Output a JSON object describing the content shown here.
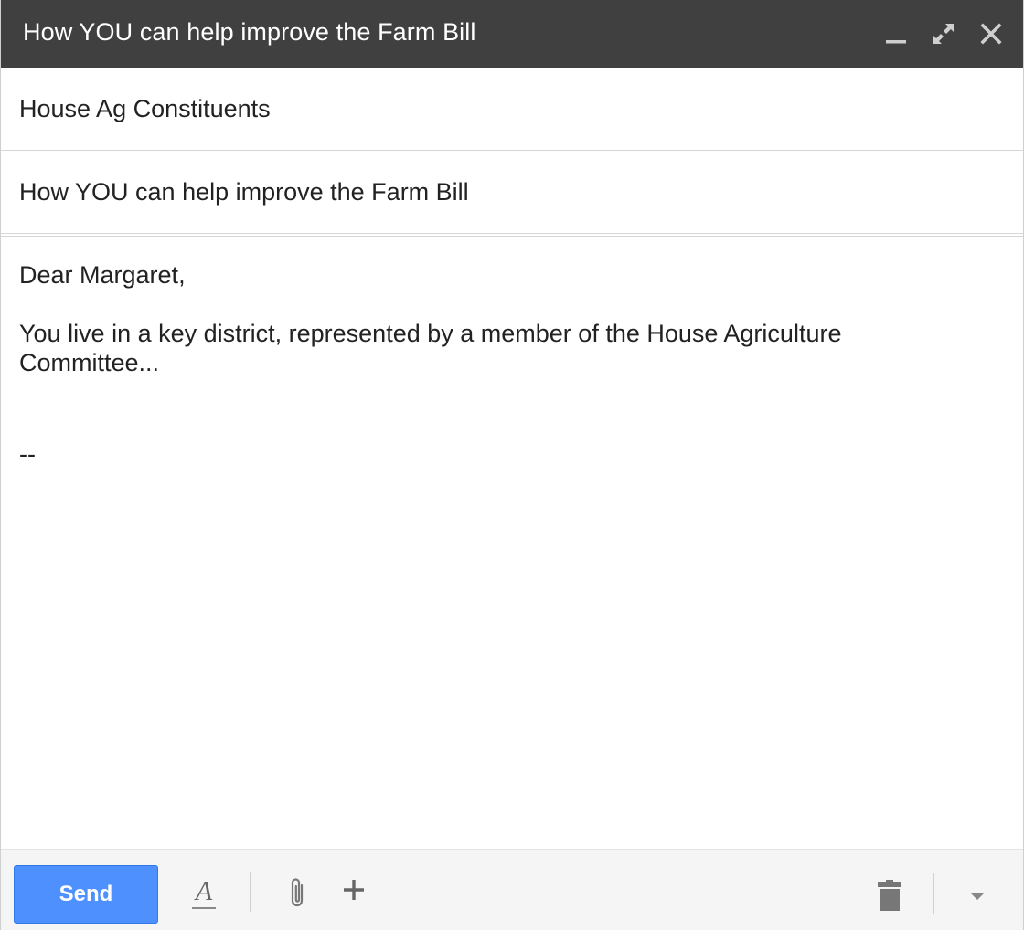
{
  "window": {
    "title": "How YOU can help improve the Farm Bill",
    "controls": {
      "minimize_icon": "minimize-icon",
      "expand_icon": "expand-icon",
      "close_icon": "close-icon"
    }
  },
  "recipients": {
    "value": "House Ag Constituents"
  },
  "subject": {
    "value": "How YOU can help improve the Farm Bill"
  },
  "message": {
    "greeting": "Dear Margaret,",
    "paragraph": "You live in a key district, represented by a member of the House Agriculture Committee...",
    "signature_separator": "--"
  },
  "toolbar": {
    "send_label": "Send",
    "format_label": "A",
    "icons": [
      "format-text-icon",
      "attach-icon",
      "more-insert-icon",
      "trash-icon",
      "more-options-icon"
    ]
  },
  "colors": {
    "titlebar": "#404040",
    "send_button": "#4d90fe",
    "toolbar_bg": "#f5f5f5"
  }
}
